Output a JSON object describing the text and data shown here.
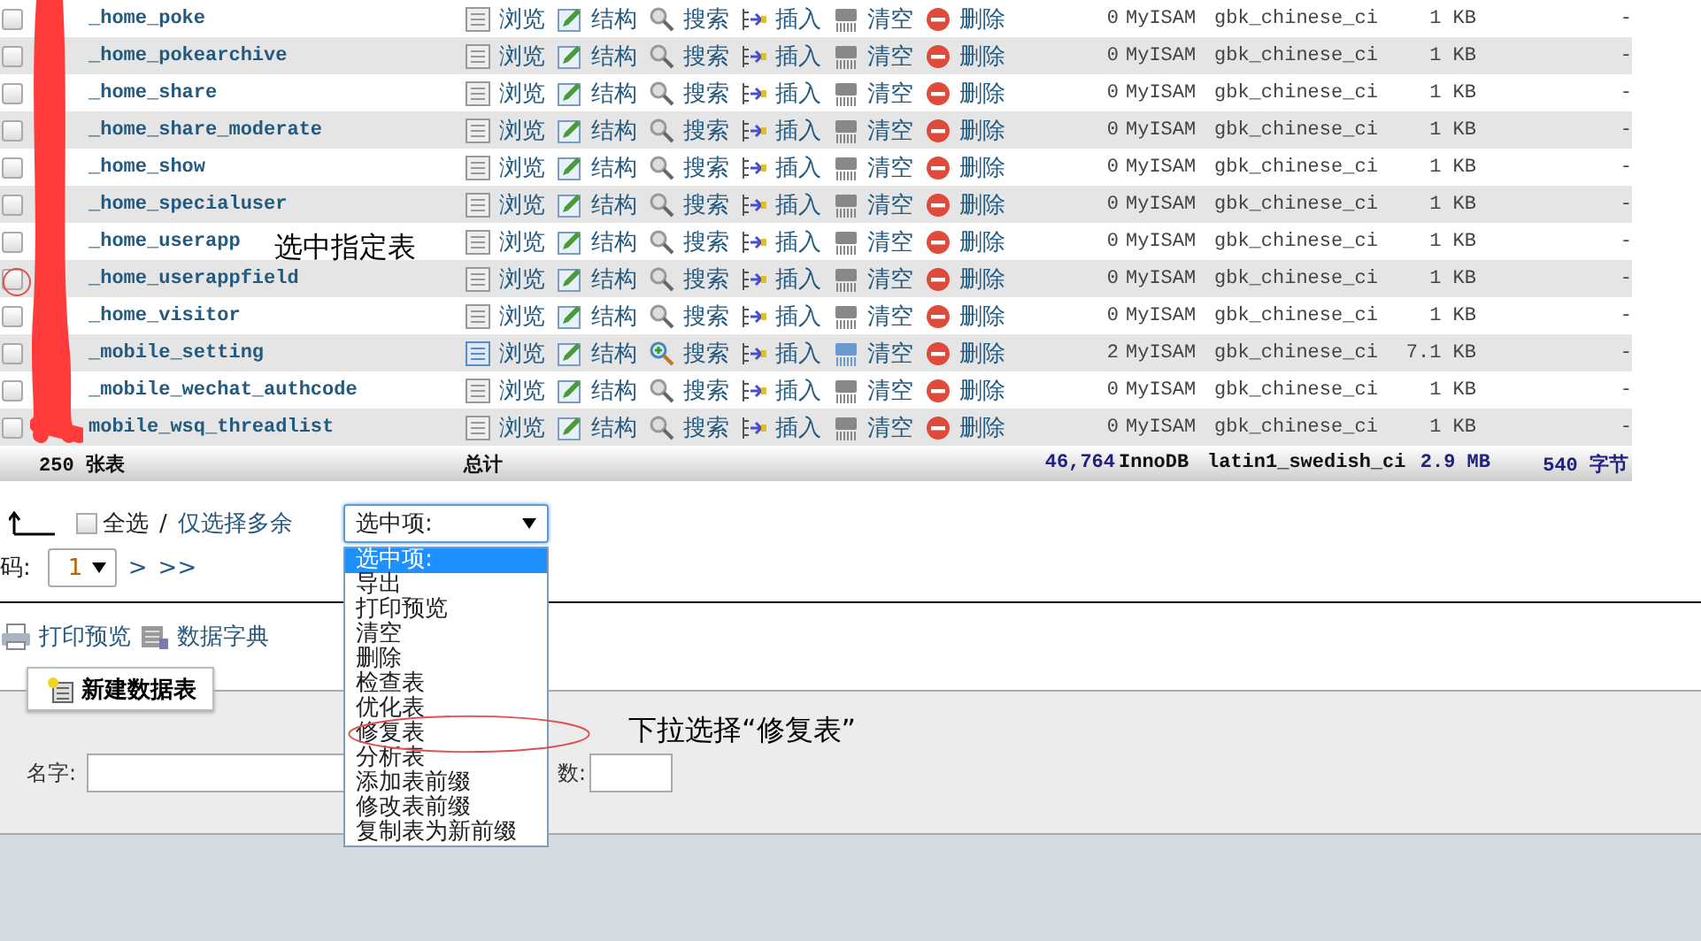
{
  "tables": [
    {
      "name": "_home_poke",
      "checked": false,
      "empty": true,
      "actions": [
        "浏览",
        "结构",
        "搜索",
        "插入",
        "清空",
        "删除"
      ],
      "rows": "0",
      "engine": "MyISAM",
      "collation": "gbk_chinese_ci",
      "size": "1 KB",
      "overhead": "-"
    },
    {
      "name": "_home_pokearchive",
      "checked": false,
      "empty": true,
      "actions": [
        "浏览",
        "结构",
        "搜索",
        "插入",
        "清空",
        "删除"
      ],
      "rows": "0",
      "engine": "MyISAM",
      "collation": "gbk_chinese_ci",
      "size": "1 KB",
      "overhead": "-"
    },
    {
      "name": "_home_share",
      "checked": false,
      "empty": true,
      "actions": [
        "浏览",
        "结构",
        "搜索",
        "插入",
        "清空",
        "删除"
      ],
      "rows": "0",
      "engine": "MyISAM",
      "collation": "gbk_chinese_ci",
      "size": "1 KB",
      "overhead": "-"
    },
    {
      "name": "_home_share_moderate",
      "checked": false,
      "empty": true,
      "actions": [
        "浏览",
        "结构",
        "搜索",
        "插入",
        "清空",
        "删除"
      ],
      "rows": "0",
      "engine": "MyISAM",
      "collation": "gbk_chinese_ci",
      "size": "1 KB",
      "overhead": "-"
    },
    {
      "name": "_home_show",
      "checked": false,
      "empty": true,
      "actions": [
        "浏览",
        "结构",
        "搜索",
        "插入",
        "清空",
        "删除"
      ],
      "rows": "0",
      "engine": "MyISAM",
      "collation": "gbk_chinese_ci",
      "size": "1 KB",
      "overhead": "-"
    },
    {
      "name": "_home_specialuser",
      "checked": false,
      "empty": true,
      "actions": [
        "浏览",
        "结构",
        "搜索",
        "插入",
        "清空",
        "删除"
      ],
      "rows": "0",
      "engine": "MyISAM",
      "collation": "gbk_chinese_ci",
      "size": "1 KB",
      "overhead": "-"
    },
    {
      "name": "_home_userapp",
      "checked": false,
      "empty": true,
      "actions": [
        "浏览",
        "结构",
        "搜索",
        "插入",
        "清空",
        "删除"
      ],
      "rows": "0",
      "engine": "MyISAM",
      "collation": "gbk_chinese_ci",
      "size": "1 KB",
      "overhead": "-"
    },
    {
      "name": "_home_userappfield",
      "checked": false,
      "empty": true,
      "actions": [
        "浏览",
        "结构",
        "搜索",
        "插入",
        "清空",
        "删除"
      ],
      "rows": "0",
      "engine": "MyISAM",
      "collation": "gbk_chinese_ci",
      "size": "1 KB",
      "overhead": "-"
    },
    {
      "name": "_home_visitor",
      "checked": false,
      "empty": true,
      "actions": [
        "浏览",
        "结构",
        "搜索",
        "插入",
        "清空",
        "删除"
      ],
      "rows": "0",
      "engine": "MyISAM",
      "collation": "gbk_chinese_ci",
      "size": "1 KB",
      "overhead": "-"
    },
    {
      "name": "_mobile_setting",
      "checked": false,
      "empty": false,
      "actions": [
        "浏览",
        "结构",
        "搜索",
        "插入",
        "清空",
        "删除"
      ],
      "rows": "2",
      "engine": "MyISAM",
      "collation": "gbk_chinese_ci",
      "size": "7.1 KB",
      "overhead": "-"
    },
    {
      "name": "_mobile_wechat_authcode",
      "checked": false,
      "empty": true,
      "actions": [
        "浏览",
        "结构",
        "搜索",
        "插入",
        "清空",
        "删除"
      ],
      "rows": "0",
      "engine": "MyISAM",
      "collation": "gbk_chinese_ci",
      "size": "1 KB",
      "overhead": "-"
    },
    {
      "name": "mobile_wsq_threadlist",
      "checked": false,
      "empty": true,
      "actions": [
        "浏览",
        "结构",
        "搜索",
        "插入",
        "清空",
        "删除"
      ],
      "rows": "0",
      "engine": "MyISAM",
      "collation": "gbk_chinese_ci",
      "size": "1 KB",
      "overhead": "-"
    }
  ],
  "summary": {
    "count": "250 张表",
    "total_label": "总计",
    "rows": "46,764",
    "engine": "InnoDB",
    "collation": "latin1_swedish_ci",
    "size": "2.9 MB",
    "overhead": "540 字节"
  },
  "selection_bar": {
    "check_all": {
      "label": "全选",
      "checked": false
    },
    "separator": "/",
    "select_overhead": "仅选择多余",
    "action_select": {
      "value": "选中项:",
      "expanded": true,
      "options": [
        {
          "label": "选中项:",
          "selected": true
        },
        {
          "label": "导出",
          "selected": false
        },
        {
          "label": "打印预览",
          "selected": false
        },
        {
          "label": "清空",
          "selected": false
        },
        {
          "label": "删除",
          "selected": false
        },
        {
          "label": "检查表",
          "selected": false
        },
        {
          "label": "优化表",
          "selected": false
        },
        {
          "label": "修复表",
          "selected": false
        },
        {
          "label": "分析表",
          "selected": false
        },
        {
          "label": "添加表前缀",
          "selected": false
        },
        {
          "label": "修改表前缀",
          "selected": false
        },
        {
          "label": "复制表为新前缀",
          "selected": false
        }
      ]
    }
  },
  "pager": {
    "label": "码:",
    "page": "1",
    "next": ">",
    "last": ">>"
  },
  "links": [
    "打印预览",
    "数据字典"
  ],
  "create_table": {
    "button": "新建数据表",
    "name_label": "名字:",
    "columns_label": "数:"
  },
  "annotations": {
    "select_hint": "选中指定表",
    "dropdown_hint": "下拉选择“修复表”"
  }
}
